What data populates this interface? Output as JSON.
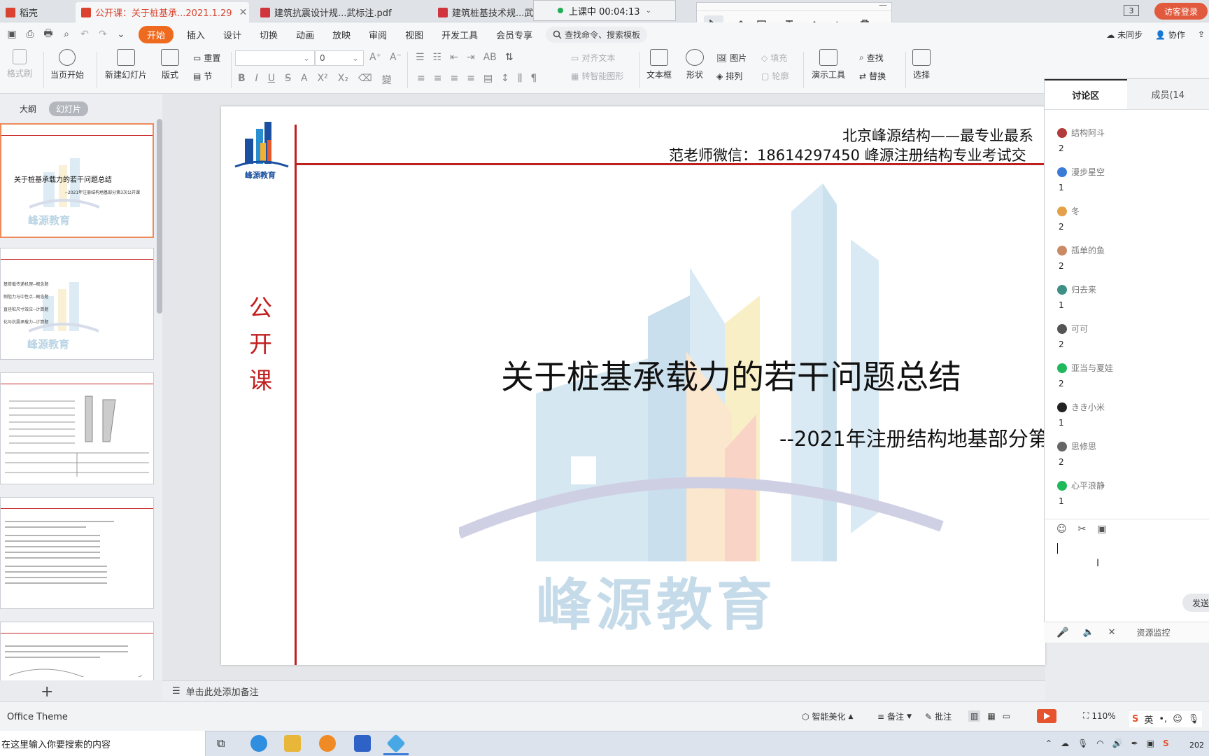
{
  "tabs": [
    {
      "label": "稻壳"
    },
    {
      "label": "公开课：关于桩基承...2021.1.29"
    },
    {
      "label": "建筑抗震设计规...武标注.pdf"
    },
    {
      "label": "建筑桩基技术规...武标"
    }
  ],
  "class_timer": {
    "label": "上课中 00:04:13"
  },
  "tab_count": "3",
  "visitor_login": "访客登录",
  "menu": {
    "items": [
      "开始",
      "插入",
      "设计",
      "切换",
      "动画",
      "放映",
      "审阅",
      "视图",
      "开发工具",
      "会员专享"
    ],
    "search_placeholder": "查找命令、搜索模板",
    "sync": "未同步",
    "collaborate": "协作"
  },
  "ribbon": {
    "format_painter": "格式刷",
    "play_from_current": "当页开始",
    "new_slide": "新建幻灯片",
    "layout": "版式",
    "reset": "重置",
    "section": "节",
    "font_size": "0",
    "align_text": "对齐文本",
    "convert_smartart": "转智能图形",
    "textbox": "文本框",
    "shape": "形状",
    "picture": "图片",
    "arrange": "排列",
    "fill": "填充",
    "outline": "轮廓",
    "presentation_tools": "演示工具",
    "find": "查找",
    "replace": "替换",
    "select": "选择"
  },
  "left_panel": {
    "outline_tab": "大纲",
    "slides_tab": "幻灯片",
    "thumb1_title": "关于桩基承载力的若干问题总结",
    "thumb1_sub": "--2021年注册结构地基部分第3次公开课",
    "thumb_watermark": "峰源教育",
    "thumb2_lines": [
      "基荷载传递机理--概念题",
      "侧阻力与中性点--概念题",
      "直径桩尺寸效应--计算题",
      "化与抗震承载力--计算题"
    ]
  },
  "slide": {
    "header_line1": "北京峰源结构——最专业最系",
    "header_line2": "范老师微信：18614297450  峰源注册结构专业考试交",
    "vertical_label": [
      "公",
      "开",
      "课"
    ],
    "logo_text": "峰源教育",
    "title": "关于桩基承载力的若干问题总结",
    "subtitle": "--2021年注册结构地基部分第",
    "watermark_text": "峰源教育"
  },
  "notes_placeholder": "单击此处添加备注",
  "discussion": {
    "tab_discussion": "讨论区",
    "tab_members": "成员(14",
    "messages": [
      {
        "user": "结构阿斗",
        "text": "2",
        "color": "#b23b3b"
      },
      {
        "user": "漫步星空",
        "text": "1",
        "color": "#3a7bd5"
      },
      {
        "user": "冬",
        "text": "2",
        "color": "#e3a24a"
      },
      {
        "user": "孤单的鱼",
        "text": "2",
        "color": "#c98a64"
      },
      {
        "user": "归去来",
        "text": "1",
        "color": "#3e8f86"
      },
      {
        "user": "可可",
        "text": "2",
        "color": "#555555"
      },
      {
        "user": "亚当与夏娃",
        "text": "2",
        "color": "#1fb85a"
      },
      {
        "user": "きき小米",
        "text": "1",
        "color": "#222222"
      },
      {
        "user": "思修思",
        "text": "2",
        "color": "#666666"
      },
      {
        "user": "心平浪静",
        "text": "1",
        "color": "#1fb85a"
      }
    ],
    "send_label": "发送",
    "resource_monitor": "资源监控"
  },
  "status": {
    "theme": "Office Theme",
    "beautify": "智能美化",
    "notes": "备注",
    "comments": "批注",
    "zoom": "110%",
    "ime_lang": "英"
  },
  "taskbar": {
    "search_placeholder": "在这里输入你要搜索的内容",
    "clock": "202"
  },
  "colors": {
    "accent_orange": "#ee6a1f",
    "slide_red": "#c01f1f",
    "live_green": "#1fae55"
  }
}
